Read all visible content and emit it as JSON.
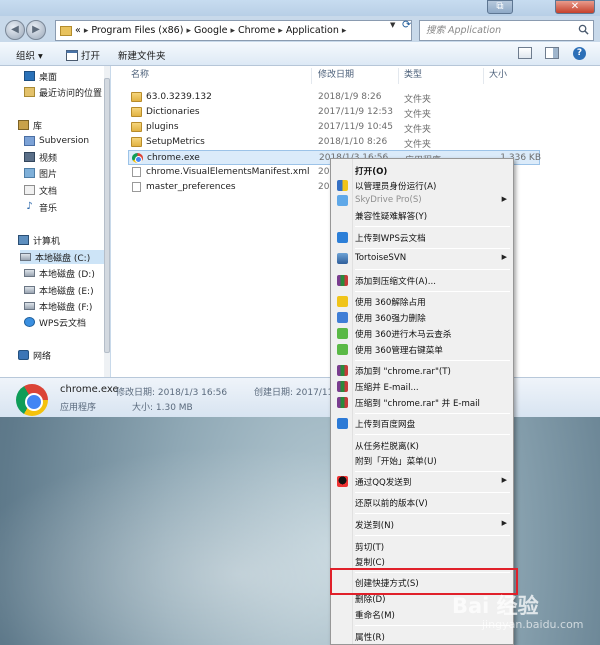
{
  "window": {
    "address": {
      "prefix": "«",
      "crumbs": [
        "Program Files (x86)",
        "Google",
        "Chrome",
        "Application"
      ]
    },
    "search_placeholder": "搜索 Application",
    "toolbar": {
      "organize": "组织 ▾",
      "open": "打开",
      "new_folder": "新建文件夹"
    }
  },
  "navpane": {
    "items": [
      {
        "label": "桌面",
        "icon": "desktop-icon"
      },
      {
        "label": "最近访问的位置",
        "icon": "recent-places-icon"
      },
      {
        "label": "库",
        "icon": "library-icon"
      },
      {
        "label": "Subversion",
        "icon": "subversion-icon"
      },
      {
        "label": "视频",
        "icon": "video-icon"
      },
      {
        "label": "图片",
        "icon": "pictures-icon"
      },
      {
        "label": "文档",
        "icon": "documents-icon"
      },
      {
        "label": "音乐",
        "icon": "music-icon"
      },
      {
        "label": "计算机",
        "icon": "computer-icon"
      },
      {
        "label": "本地磁盘 (C:)",
        "icon": "drive-icon"
      },
      {
        "label": "本地磁盘 (D:)",
        "icon": "drive-icon"
      },
      {
        "label": "本地磁盘 (E:)",
        "icon": "drive-icon"
      },
      {
        "label": "本地磁盘 (F:)",
        "icon": "drive-icon"
      },
      {
        "label": "WPS云文档",
        "icon": "wps-cloud-icon"
      },
      {
        "label": "网络",
        "icon": "network-icon"
      }
    ]
  },
  "filelist": {
    "columns": {
      "name": "名称",
      "date": "修改日期",
      "type": "类型",
      "size": "大小"
    },
    "rows": [
      {
        "name": "63.0.3239.132",
        "date": "2018/1/9 8:26",
        "type": "文件夹",
        "size": ""
      },
      {
        "name": "Dictionaries",
        "date": "2017/11/9 12:53",
        "type": "文件夹",
        "size": ""
      },
      {
        "name": "plugins",
        "date": "2017/11/9 10:45",
        "type": "文件夹",
        "size": ""
      },
      {
        "name": "SetupMetrics",
        "date": "2018/1/10 8:26",
        "type": "文件夹",
        "size": ""
      },
      {
        "name": "chrome.exe",
        "date": "2018/1/3 16:56",
        "type": "应用程序",
        "size": "1,336 KB"
      },
      {
        "name": "chrome.VisualElementsManifest.xml",
        "date": "20",
        "type": "",
        "size": ""
      },
      {
        "name": "master_preferences",
        "date": "20",
        "type": "",
        "size": ""
      }
    ]
  },
  "details": {
    "filename": "chrome.exe",
    "modified_label": "修改日期: 2018/1/3 16:56",
    "created_label": "创建日期: 2017/11/",
    "type": "应用程序",
    "size_label": "大小: 1.30 MB"
  },
  "context_menu": {
    "items": [
      {
        "label": "打开(O)",
        "bold": true,
        "icon": "",
        "submenu": false
      },
      {
        "label": "以管理员身份运行(A)",
        "icon": "uac-shield-icon",
        "submenu": false
      },
      {
        "label": "SkyDrive Pro(S)",
        "disabled": true,
        "icon": "skydrive-icon",
        "submenu": true
      },
      {
        "label": "兼容性疑难解答(Y)",
        "icon": "",
        "submenu": false
      },
      {
        "label": "上传到WPS云文档",
        "icon": "wps-icon",
        "submenu": false
      },
      {
        "label": "TortoiseSVN",
        "icon": "tortoisesvn-icon",
        "submenu": true
      },
      {
        "label": "添加到压缩文件(A)...",
        "icon": "winrar-icon",
        "submenu": false
      },
      {
        "label": "使用 360解除占用",
        "icon": "360-unlock-icon",
        "submenu": false
      },
      {
        "label": "使用 360强力删除",
        "icon": "360-delete-icon",
        "submenu": false
      },
      {
        "label": "使用 360进行木马云查杀",
        "icon": "360-scan-icon",
        "submenu": false
      },
      {
        "label": "使用 360管理右键菜单",
        "icon": "360-menu-icon",
        "submenu": false
      },
      {
        "label": "添加到 \"chrome.rar\"(T)",
        "icon": "winrar-icon",
        "submenu": false
      },
      {
        "label": "压缩并 E-mail...",
        "icon": "winrar-icon",
        "submenu": false
      },
      {
        "label": "压缩到 \"chrome.rar\" 并 E-mail",
        "icon": "winrar-icon",
        "submenu": false
      },
      {
        "label": "上传到百度网盘",
        "icon": "baidu-netdisk-icon",
        "submenu": false
      },
      {
        "label": "从任务栏脱离(K)",
        "icon": "",
        "submenu": false
      },
      {
        "label": "附到「开始」菜单(U)",
        "icon": "",
        "submenu": false
      },
      {
        "label": "通过QQ发送到",
        "icon": "qq-icon",
        "submenu": true
      },
      {
        "label": "还原以前的版本(V)",
        "icon": "",
        "submenu": false
      },
      {
        "label": "发送到(N)",
        "icon": "",
        "submenu": true
      },
      {
        "label": "剪切(T)",
        "icon": "",
        "submenu": false
      },
      {
        "label": "复制(C)",
        "icon": "",
        "submenu": false
      },
      {
        "label": "创建快捷方式(S)",
        "icon": "",
        "submenu": false
      },
      {
        "label": "删除(D)",
        "icon": "",
        "submenu": false
      },
      {
        "label": "重命名(M)",
        "icon": "",
        "submenu": false
      },
      {
        "label": "属性(R)",
        "icon": "",
        "submenu": false
      }
    ],
    "highlighted": "创建快捷方式(S)",
    "highlight_color": "#e0202a"
  },
  "watermark": {
    "main": "Bai 经验",
    "sub": "jingyan.baidu.com"
  }
}
